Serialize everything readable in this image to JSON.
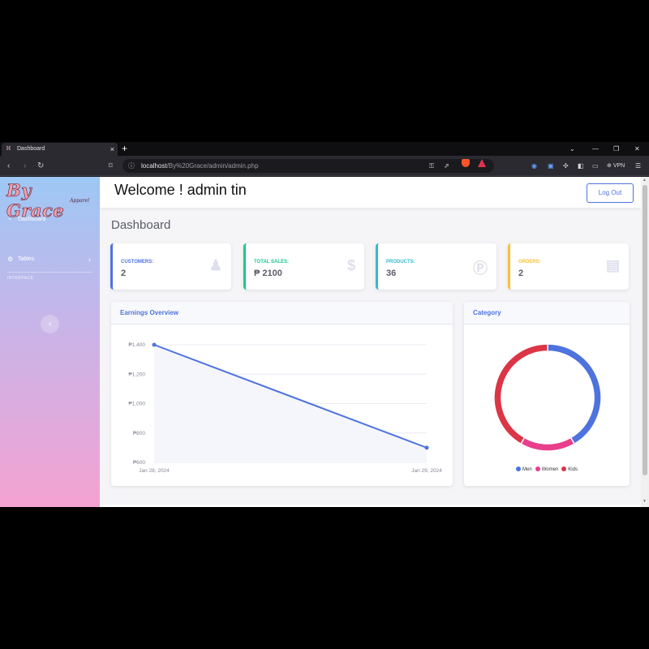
{
  "browser": {
    "tab_title": "Dashboard",
    "tab_close": "×",
    "new_tab": "+",
    "url_host": "localhost",
    "url_path": "/By%20Grace/admin/admin.php",
    "vpn_label": "VPN"
  },
  "sidebar": {
    "brand": "By Grace",
    "brand_sub": "Apparel",
    "items": [
      {
        "label": "Dashboard",
        "icon": "dashboard-icon"
      },
      {
        "label": "Tables",
        "icon": "table-icon"
      }
    ],
    "heading": "INTERFACE",
    "toggle_glyph": "‹"
  },
  "topbar": {
    "welcome": "Welcome ! admin tin",
    "logout": "Log Out"
  },
  "page": {
    "title": "Dashboard"
  },
  "stats": [
    {
      "label": "CUSTOMERS:",
      "value": "2",
      "color": "#4e73df",
      "icon": "user-icon"
    },
    {
      "label": "TOTAL SALES:",
      "value": "₱ 2100",
      "color": "#1cc88a",
      "icon": "dollar-icon"
    },
    {
      "label": "PRODUCTS:",
      "value": "36",
      "color": "#36b9cc",
      "icon": "peso-coin-icon"
    },
    {
      "label": "ORDERS:",
      "value": "2",
      "color": "#f6c23e",
      "icon": "clipboard-icon"
    }
  ],
  "earnings": {
    "title": "Earnings Overview"
  },
  "category": {
    "title": "Category"
  },
  "chart_data": [
    {
      "type": "line",
      "title": "Earnings Overview",
      "x": [
        "Jan 28, 2024",
        "Jan 29, 2024"
      ],
      "series": [
        {
          "values": [
            1400,
            700
          ],
          "color": "#4e73df"
        }
      ],
      "ylim": [
        600,
        1400
      ],
      "yticks": [
        "₱1,400",
        "₱1,200",
        "₱1,000",
        "₱800",
        "₱600"
      ],
      "grid": true,
      "fill": "#f5f6fb"
    },
    {
      "type": "pie",
      "title": "Category",
      "labels": [
        "Men",
        "Women",
        "Kids"
      ],
      "values": [
        5,
        2,
        5
      ],
      "colors": [
        "#4e73df",
        "#e83e8c",
        "#dc3545"
      ],
      "legend_position": "bottom"
    }
  ]
}
